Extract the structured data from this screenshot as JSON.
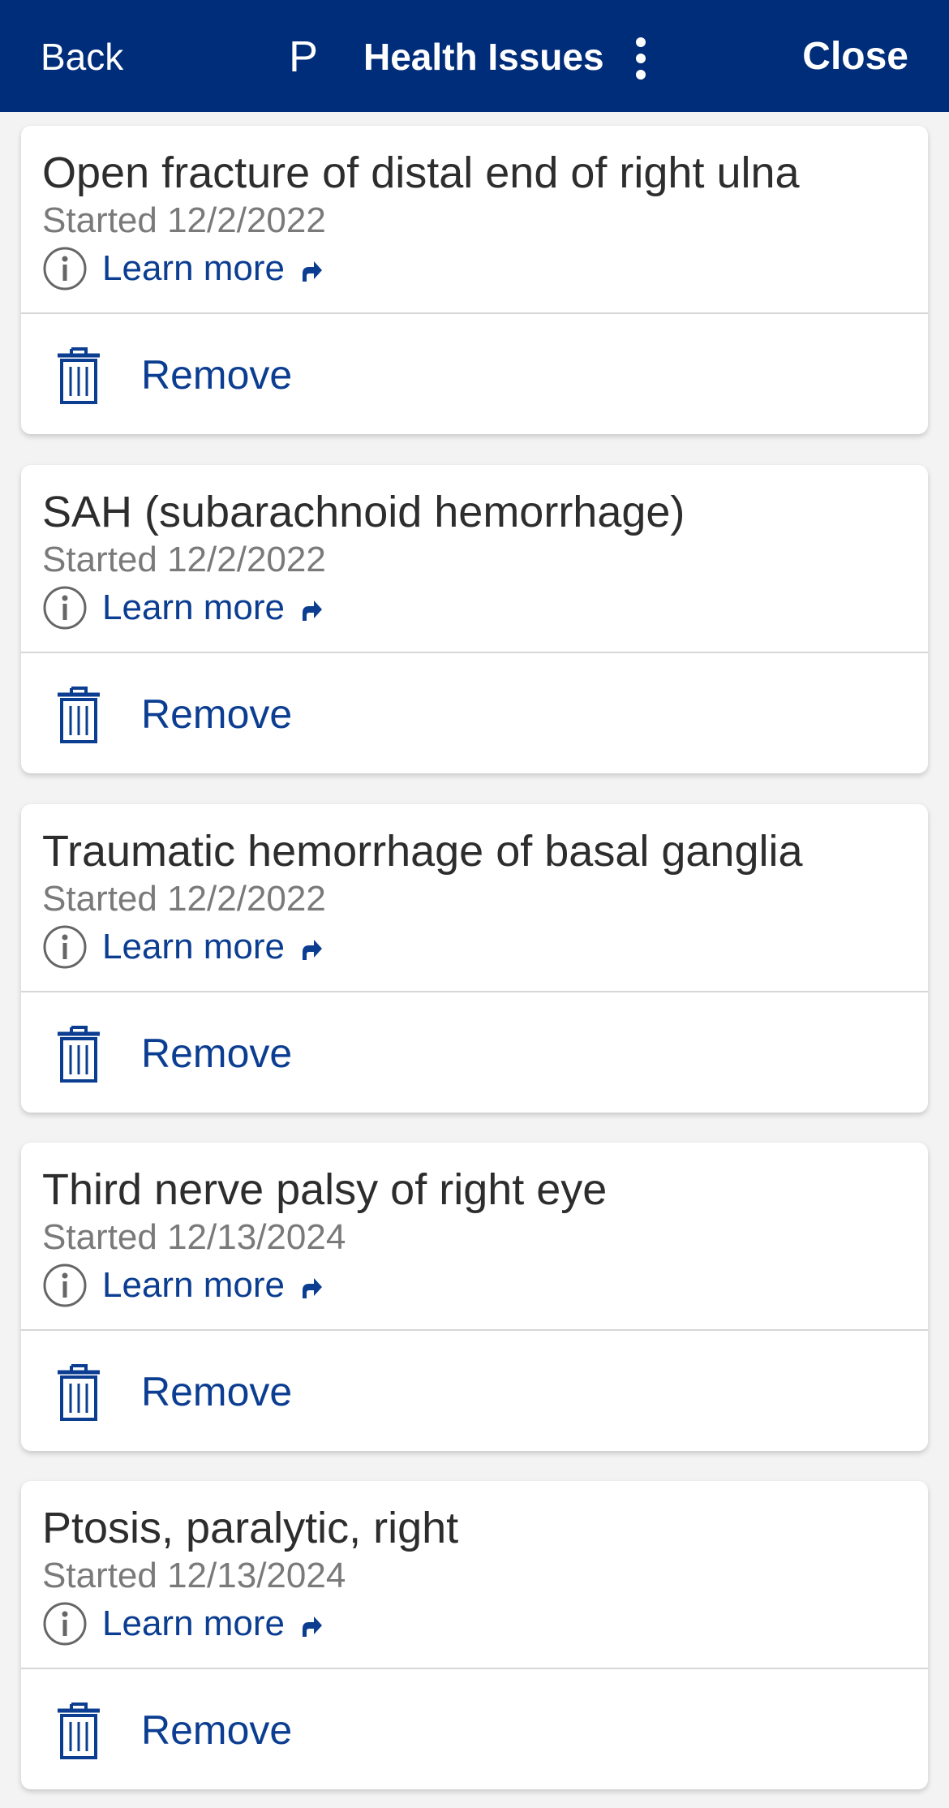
{
  "header": {
    "back_label": "Back",
    "avatar_initial": "P",
    "title": "Health Issues",
    "close_label": "Close"
  },
  "colors": {
    "header_bg": "#002d7a",
    "link": "#0b3d91",
    "title_text": "#2d2d2d",
    "date_text": "#7a7a7a",
    "page_bg": "#f3f3f3"
  },
  "icons": {
    "info": "info-circle-icon",
    "external": "external-link-icon",
    "trash": "trash-icon",
    "more": "more-vertical-icon"
  },
  "issues": [
    {
      "title": "Open fracture of distal end of right ulna",
      "started": "Started 12/2/2022",
      "learn_more": "Learn more",
      "remove": "Remove"
    },
    {
      "title": "SAH (subarachnoid hemorrhage)",
      "started": "Started 12/2/2022",
      "learn_more": "Learn more",
      "remove": "Remove"
    },
    {
      "title": "Traumatic hemorrhage of basal ganglia",
      "started": "Started 12/2/2022",
      "learn_more": "Learn more",
      "remove": "Remove"
    },
    {
      "title": "Third nerve palsy of right eye",
      "started": "Started 12/13/2024",
      "learn_more": "Learn more",
      "remove": "Remove"
    },
    {
      "title": "Ptosis, paralytic, right",
      "started": "Started 12/13/2024",
      "learn_more": "Learn more",
      "remove": "Remove"
    }
  ]
}
